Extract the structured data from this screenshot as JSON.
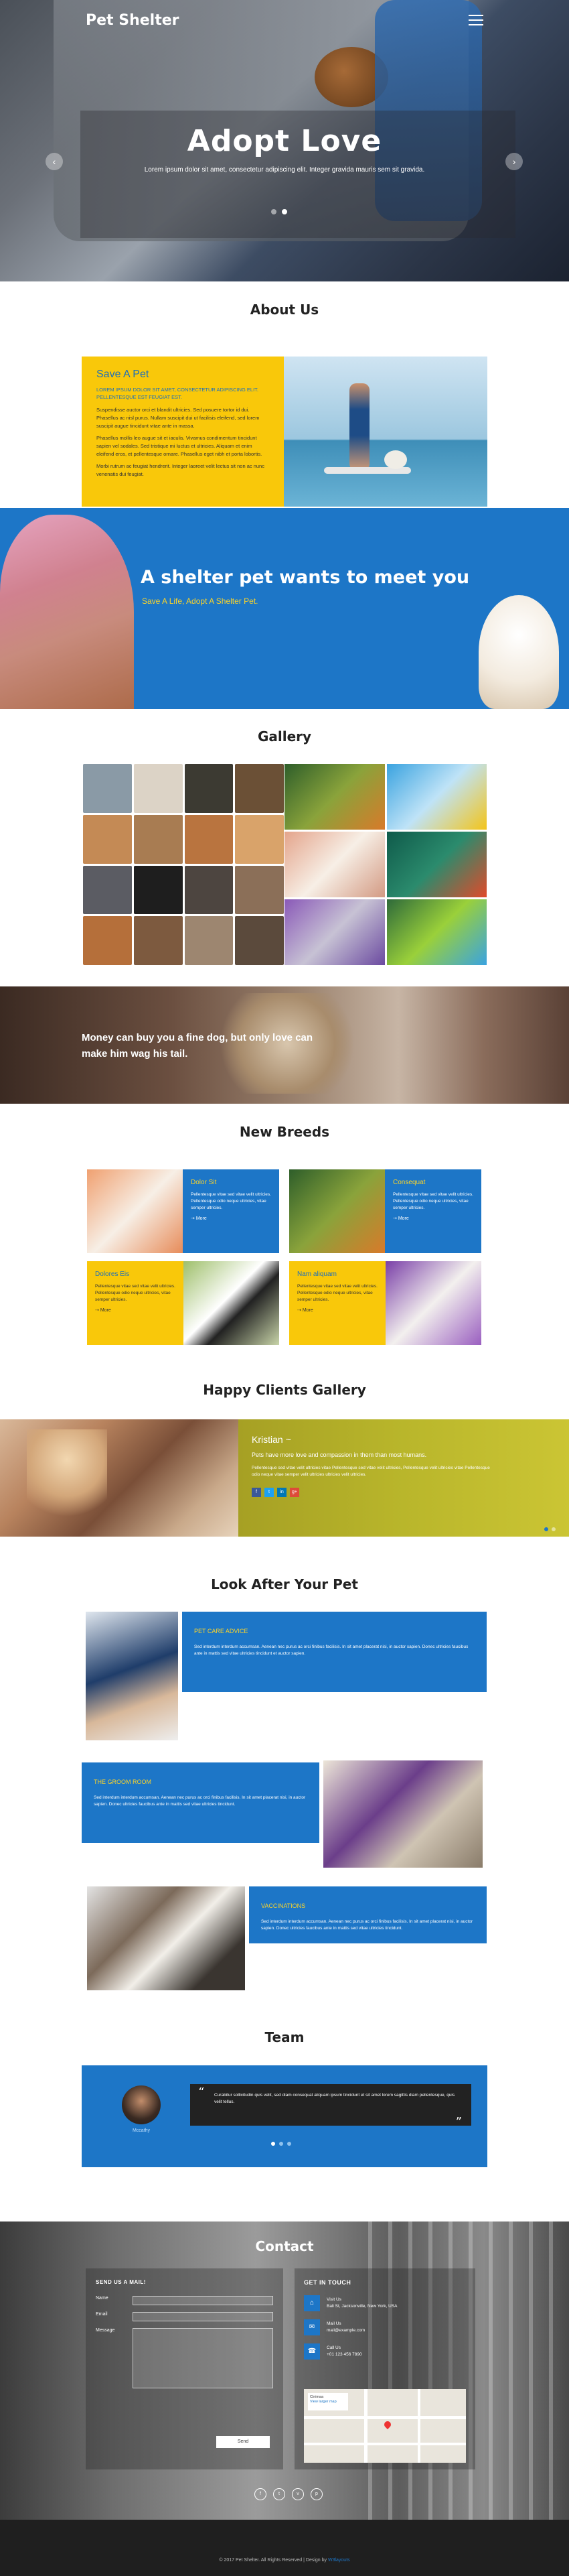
{
  "nav": {
    "brand": "Pet Shelter"
  },
  "hero": {
    "title": "Adopt Love",
    "subtitle": "Lorem ipsum dolor sit amet, consectetur adipiscing elit. Integer gravida mauris sem sit gravida.",
    "prev_icon": "chevron-left-icon",
    "next_icon": "chevron-right-icon",
    "prev_glyph": "‹",
    "next_glyph": "›"
  },
  "about": {
    "title": "About Us",
    "heading": "Save A Pet",
    "caps": "Lorem ipsum dolor sit amet, consectetur adipiscing elit. Pellentesque est feugiat est.",
    "p1": "Suspendisse auctor orci et blandit ultricies. Sed posuere tortor id dui. Phasellus ac nisl purus. Nullam suscipit dui ut facilisis eleifend, sed lorem suscipit augue tincidunt vitae ante in massa.",
    "p2": "Phasellus mollis leo augue sit et iaculis. Vivamus condimentum tincidunt sapien vel sodales. Sed tristique mi luctus et ultricies. Aliquam et enim eleifend eros, et pellentesque ornare. Phasellus eget nibh et porta lobortis.",
    "p3": "Morbi rutrum ac feugiat hendrerit. Integer laoreet velit lectus sit non ac nunc venenatis dui feugiat."
  },
  "banner": {
    "title": "A shelter pet wants to meet you",
    "subtitle": "Save A Life, Adopt A Shelter Pet."
  },
  "gallery": {
    "title": "Gallery"
  },
  "quote": {
    "text": "Money can buy you a fine dog, but only love can make him wag his tail."
  },
  "breeds": {
    "title": "New Breeds",
    "items": [
      {
        "name": "Dolor Sit",
        "text": "Pellentesque vitae sed vitae velit ultricies. Pellentesque odio neque ultricies, vitae semper ultricies.",
        "more": "More"
      },
      {
        "name": "Consequat",
        "text": "Pellentesque vitae sed vitae velit ultricies. Pellentesque odio neque ultricies, vitae semper ultricies.",
        "more": "More"
      },
      {
        "name": "Dolores Eis",
        "text": "Pellentesque vitae sed vitae velit ultricies. Pellentesque odio neque ultricies, vitae semper ultricies.",
        "more": "More"
      },
      {
        "name": "Nam aliquam",
        "text": "Pellentesque vitae sed vitae velit ultricies. Pellentesque odio neque ultricies, vitae semper ultricies.",
        "more": "More"
      }
    ]
  },
  "clients": {
    "title": "Happy Clients Gallery",
    "name": "Kristian ~",
    "lead": "Pets have more love and compassion in them than most humans.",
    "text": "Pellentesque sed vitae velit ultricies vitae Pellentesque sed vitae velit ultricies, Pellentesque velit ultricies vitae Pellentesque odio neque vitae semper velit ultricies ultricies velit ultricies."
  },
  "look": {
    "title": "Look After Your Pet",
    "items": [
      {
        "heading": "PET CARE ADVICE",
        "text": "Sed interdum interdum accumsan. Aenean nec purus ac orci finibus facilisis. In sit amet placerat nisi, in auctor sapien. Donec ultricies faucibus ante in mattis sed vitae ultricies tincidunt et auctor sapien."
      },
      {
        "heading": "THE GROOM ROOM",
        "text": "Sed interdum interdum accumsan. Aenean nec purus ac orci finibus facilisis. In sit amet placerat nisi, in auctor sapien. Donec ultricies faucibus ante in mattis sed vitae ultricies tincidunt."
      },
      {
        "heading": "VACCINATIONS",
        "text": "Sed interdum interdum accumsan. Aenean nec purus ac orci finibus facilisis. In sit amet placerat nisi, in auctor sapien. Donec ultricies faucibus ante in mattis sed vitae ultricies tincidunt."
      }
    ]
  },
  "team": {
    "title": "Team",
    "member": "Mccathy",
    "quote": "Curabitur sollicitudin quis velit, sed diam consequat aliquam ipsum tincidunt et sit amet lorem sagittis diam pellentesque, quis velit tellus.",
    "open_quote": "“",
    "close_quote": "”"
  },
  "contact": {
    "title": "Contact",
    "form_title": "SEND US A MAIL!",
    "name_label": "Name",
    "email_label": "Email",
    "message_label": "Message",
    "send": "Send",
    "info_title": "GET IN TOUCH",
    "address_label": "Visit Us",
    "address": "Bali St, Jacksonville, New York, USA",
    "email_label2": "Mail Us",
    "email": "mail@example.com",
    "phone_label": "Call Us",
    "phone": "+01 123 456 7890",
    "map_label": "Cinimaa",
    "map_sub": "View larger map"
  },
  "footer": {
    "text": "© 2017 Pet Shelter. All Rights Reserved | Design by ",
    "link": "W3layouts"
  },
  "colors": {
    "blue": "#1d76c7",
    "yellow": "#f9c80a",
    "olive": "#b9b62b",
    "dark": "#1f1f1f"
  }
}
